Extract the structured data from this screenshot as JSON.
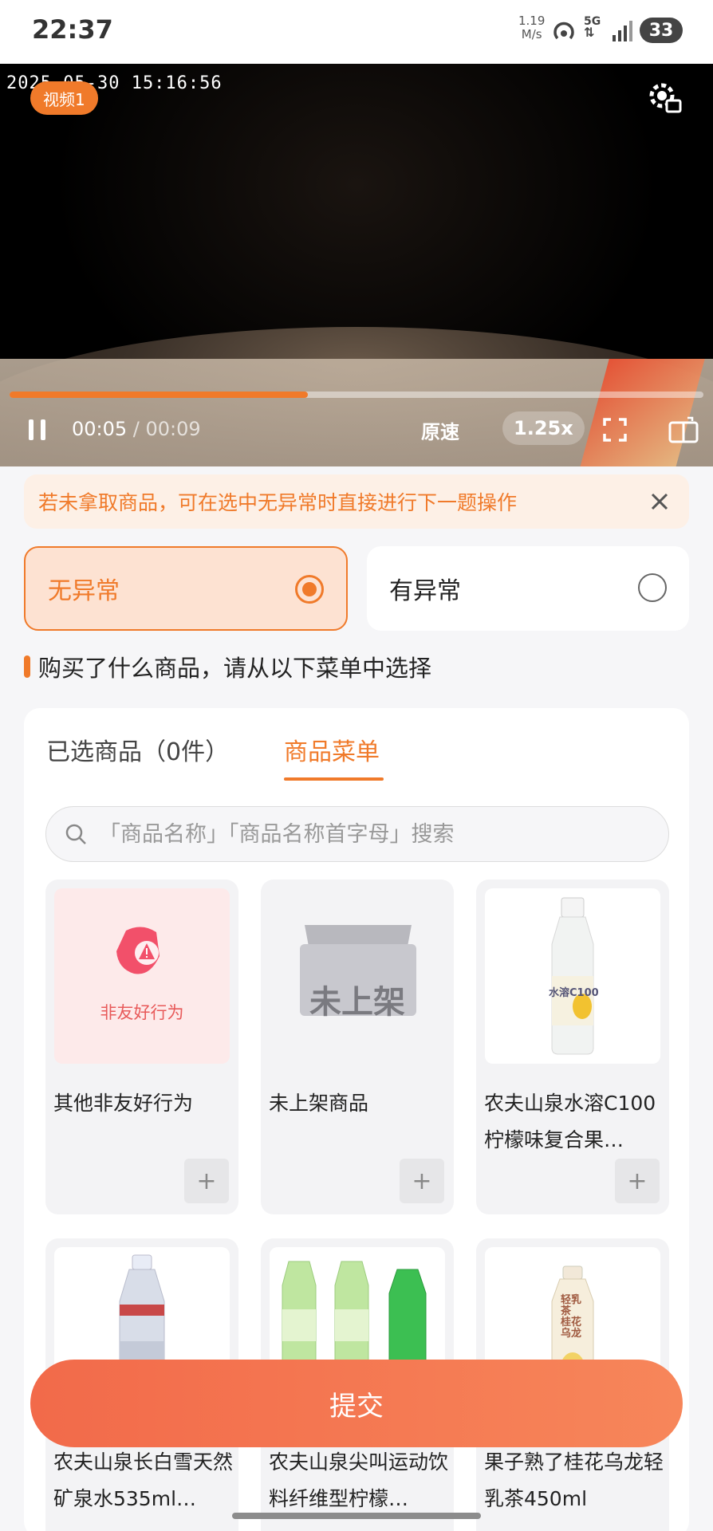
{
  "status_bar": {
    "time": "22:37",
    "net_speed_value": "1.19",
    "net_speed_unit": "M/s",
    "network": "5G",
    "battery": "33"
  },
  "video": {
    "timestamp": "2025-05-30 15:16:56",
    "tag": "视频1",
    "progress": 0.43,
    "current_time": "00:05",
    "separator": " / ",
    "duration": "00:09",
    "speed_normal": "原速",
    "speed_fast": "1.25x"
  },
  "notice": {
    "text": "若未拿取商品，可在选中无异常时直接进行下一题操作"
  },
  "options": {
    "normal": "无异常",
    "abnormal": "有异常",
    "selected": "normal"
  },
  "section": {
    "title": "购买了什么商品，请从以下菜单中选择"
  },
  "tabs": {
    "selected_items": "已选商品（0件）",
    "menu": "商品菜单"
  },
  "search": {
    "placeholder": "「商品名称」「商品名称首字母」搜索"
  },
  "products": [
    {
      "name": "其他非友好行为",
      "image_label": "非友好行为",
      "icon": "warning-icon"
    },
    {
      "name": "未上架商品",
      "image_label": "未上架",
      "icon": "box-icon"
    },
    {
      "name": "农夫山泉水溶C100柠檬味复合果…",
      "image_label": "水溶C100",
      "icon": "bottle-icon"
    },
    {
      "name": "农夫山泉长白雪天然矿泉水535ml…",
      "image_label": "",
      "icon": "bottle-icon"
    },
    {
      "name": "农夫山泉尖叫运动饮料纤维型柠檬…",
      "image_label": "",
      "icon": "bottle-icon"
    },
    {
      "name": "果子熟了桂花乌龙轻乳茶450ml",
      "image_label": "轻乳茶 桂花乌龙",
      "icon": "bottle-icon"
    }
  ],
  "submit": {
    "label": "提交"
  },
  "colors": {
    "accent": "#f07a2a",
    "submit_start": "#f26a4a",
    "submit_end": "#f7865a"
  }
}
